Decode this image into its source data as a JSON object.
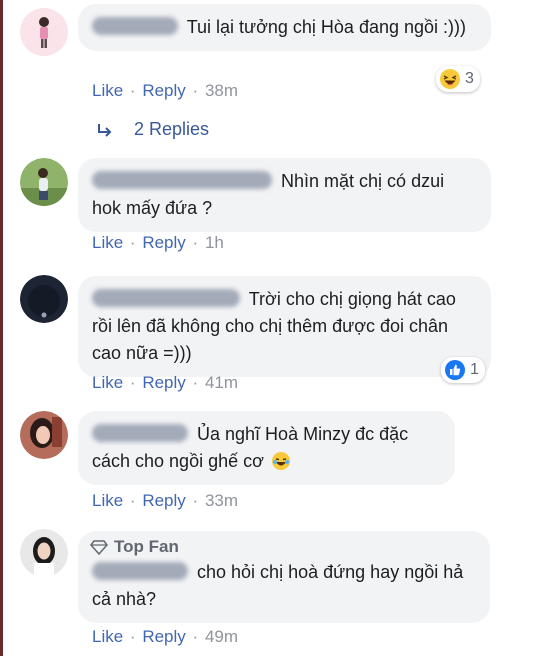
{
  "comments": [
    {
      "text": "Tui lại tưởng chị Hòa đang ngồi :)))",
      "reaction": {
        "icon": "haha-reaction-icon",
        "count": "3"
      },
      "like_label": "Like",
      "reply_label": "Reply",
      "time": "38m"
    },
    {
      "text": "Nhìn mặt chị có dzui hok mấy đứa ?",
      "like_label": "Like",
      "reply_label": "Reply",
      "time": "1h"
    },
    {
      "text": "Trời cho chị giọng hát cao rồi lên đã không cho chị thêm được đoi chân cao nữa =)))",
      "reaction": {
        "icon": "like-reaction-icon",
        "count": "1"
      },
      "like_label": "Like",
      "reply_label": "Reply",
      "time": "41m"
    },
    {
      "text": "Ủa nghĩ Hoà Minzy đc đặc cách cho ngồi ghế cơ",
      "emoji": "laughing-tears-emoji",
      "like_label": "Like",
      "reply_label": "Reply",
      "time": "33m"
    },
    {
      "badge": "Top Fan",
      "text": "cho hỏi chị hoà đứng hay ngồi hả cả nhà?",
      "like_label": "Like",
      "reply_label": "Reply",
      "time": "49m"
    }
  ],
  "replies_link": {
    "label": "2 Replies",
    "icon": "reply-arrow-icon"
  },
  "colors": {
    "link": "#4267b2",
    "bubble": "#f2f3f5",
    "meta": "#90949c"
  }
}
